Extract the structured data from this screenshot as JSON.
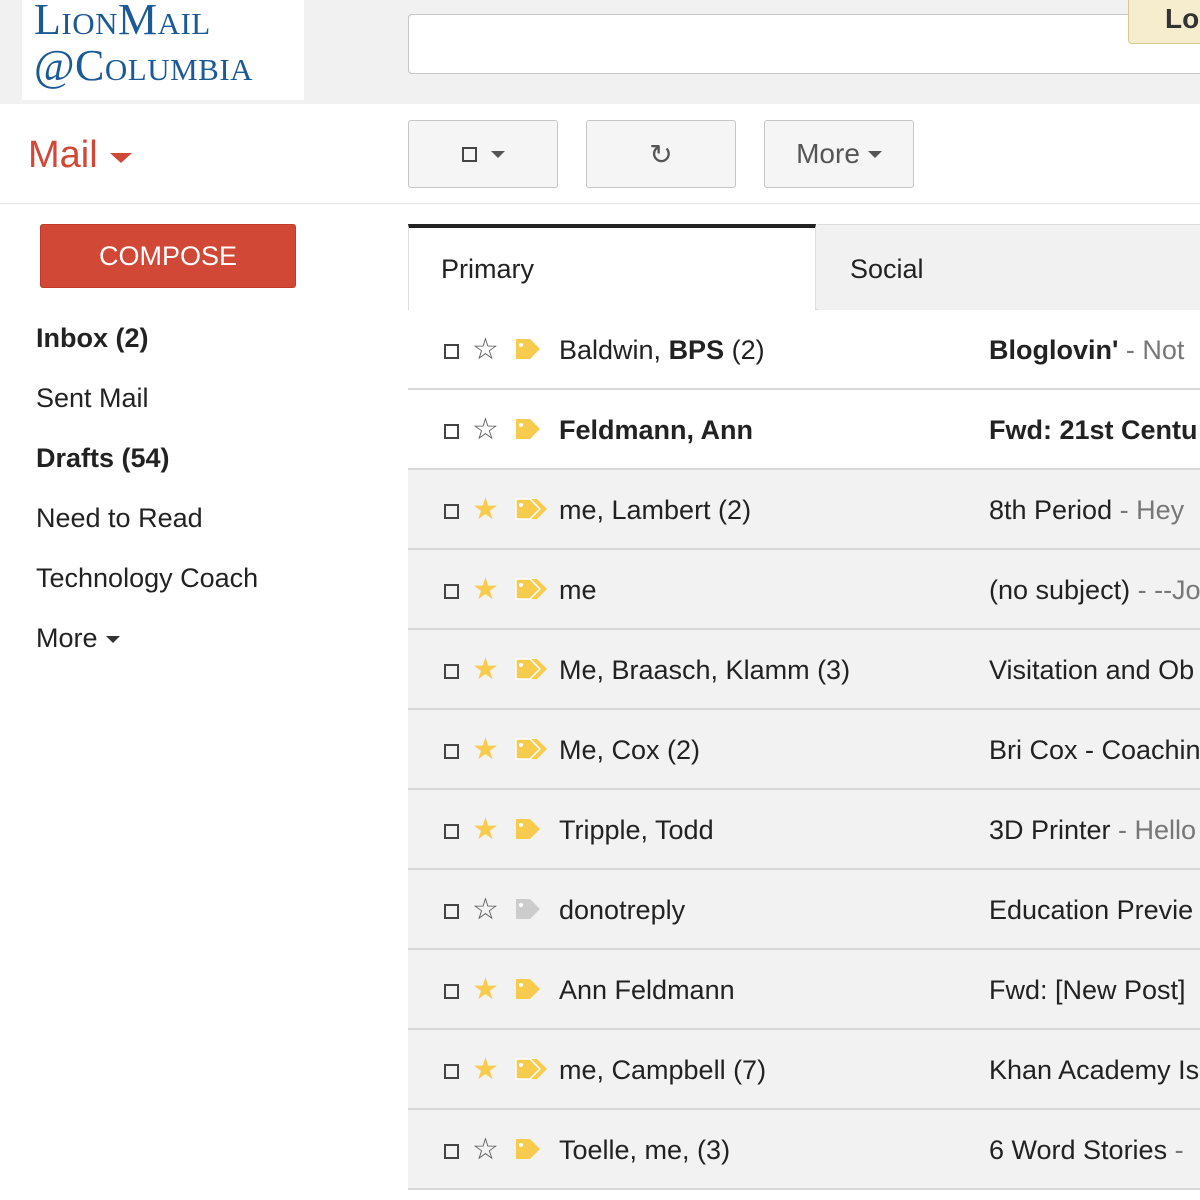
{
  "header": {
    "logo_line1": "LionMail",
    "logo_line2": "@Columbia",
    "search_placeholder": "",
    "logout_label": "Lo"
  },
  "toolbar": {
    "mail_label": "Mail",
    "refresh_glyph": "↻",
    "more_label": "More"
  },
  "sidebar": {
    "compose_label": "COMPOSE",
    "items": [
      {
        "label": "Inbox (2)",
        "bold": true
      },
      {
        "label": "Sent Mail",
        "bold": false
      },
      {
        "label": "Drafts (54)",
        "bold": true
      },
      {
        "label": "Need to Read",
        "bold": false
      },
      {
        "label": "Technology Coach",
        "bold": false
      },
      {
        "label": "More",
        "bold": false
      }
    ]
  },
  "tabs": [
    {
      "label": "Primary",
      "active": true
    },
    {
      "label": "Social",
      "active": false
    }
  ],
  "messages": [
    {
      "sender_pre": "Baldwin, ",
      "sender_bold": "BPS",
      "sender_post": " (2)",
      "subject": "Bloglovin'",
      "snippet": " - Not",
      "starred": false,
      "label_color": "#f7cb4d",
      "label_double": false,
      "unread": true,
      "subject_bold": true
    },
    {
      "sender_pre": "",
      "sender_bold": "Feldmann, Ann",
      "sender_post": "",
      "subject": "Fwd: 21st Centu",
      "snippet": "",
      "starred": false,
      "label_color": "#f7cb4d",
      "label_double": false,
      "unread": true,
      "subject_bold": true
    },
    {
      "sender_pre": "me, Lambert (2)",
      "sender_bold": "",
      "sender_post": "",
      "subject": "8th Period",
      "snippet": " - Hey",
      "starred": true,
      "label_color": "#f7cb4d",
      "label_double": true,
      "unread": false,
      "subject_bold": false
    },
    {
      "sender_pre": "me",
      "sender_bold": "",
      "sender_post": "",
      "subject": "(no subject)",
      "snippet": " - --Jo",
      "starred": true,
      "label_color": "#f7cb4d",
      "label_double": true,
      "unread": false,
      "subject_bold": false
    },
    {
      "sender_pre": "Me, Braasch, Klamm (3)",
      "sender_bold": "",
      "sender_post": "",
      "subject": "Visitation and Ob",
      "snippet": "",
      "starred": true,
      "label_color": "#f7cb4d",
      "label_double": true,
      "unread": false,
      "subject_bold": false
    },
    {
      "sender_pre": "Me, Cox (2)",
      "sender_bold": "",
      "sender_post": "",
      "subject": "Bri Cox - Coachin",
      "snippet": "",
      "starred": true,
      "label_color": "#f7cb4d",
      "label_double": true,
      "unread": false,
      "subject_bold": false
    },
    {
      "sender_pre": "Tripple, Todd",
      "sender_bold": "",
      "sender_post": "",
      "subject": "3D Printer",
      "snippet": " - Hello",
      "starred": true,
      "label_color": "#f7cb4d",
      "label_double": false,
      "unread": false,
      "subject_bold": false
    },
    {
      "sender_pre": "donotreply",
      "sender_bold": "",
      "sender_post": "",
      "subject": "Education Previe",
      "snippet": "",
      "starred": false,
      "label_color": "#cccccc",
      "label_double": false,
      "unread": false,
      "subject_bold": false
    },
    {
      "sender_pre": "Ann Feldmann",
      "sender_bold": "",
      "sender_post": "",
      "subject": "Fwd: [New Post]",
      "snippet": "",
      "starred": true,
      "label_color": "#f7cb4d",
      "label_double": false,
      "unread": false,
      "subject_bold": false
    },
    {
      "sender_pre": "me, Campbell (7)",
      "sender_bold": "",
      "sender_post": "",
      "subject": "Khan Academy Is",
      "snippet": "",
      "starred": true,
      "label_color": "#f7cb4d",
      "label_double": true,
      "unread": false,
      "subject_bold": false
    },
    {
      "sender_pre": "Toelle, me, (3)",
      "sender_bold": "",
      "sender_post": "",
      "subject": "6 Word Stories",
      "snippet": " -",
      "starred": false,
      "label_color": "#f7cb4d",
      "label_double": false,
      "unread": false,
      "subject_bold": false
    }
  ]
}
